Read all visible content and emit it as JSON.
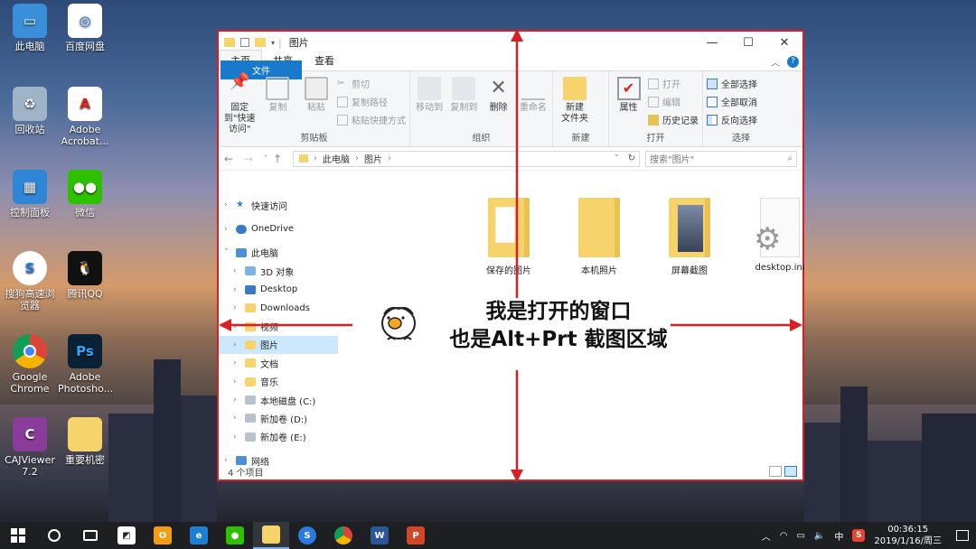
{
  "desktop_icons": [
    {
      "label": "此电脑",
      "icon": "pc-icon"
    },
    {
      "label": "百度网盘",
      "icon": "baidu-netdisk-icon"
    },
    {
      "label": "回收站",
      "icon": "recycle-bin-icon"
    },
    {
      "label": "Adobe Acrobat...",
      "icon": "acrobat-icon"
    },
    {
      "label": "控制面板",
      "icon": "control-panel-icon"
    },
    {
      "label": "微信",
      "icon": "wechat-icon"
    },
    {
      "label": "搜狗高速浏览器",
      "icon": "sogou-browser-icon"
    },
    {
      "label": "腾讯QQ",
      "icon": "qq-icon"
    },
    {
      "label": "Google Chrome",
      "icon": "chrome-icon"
    },
    {
      "label": "Adobe Photosho...",
      "icon": "photoshop-icon"
    },
    {
      "label": "CAJViewer 7.2",
      "icon": "cajviewer-icon"
    },
    {
      "label": "重要机密",
      "icon": "folder-icon"
    }
  ],
  "window": {
    "title": "图片",
    "tabs": [
      "文件",
      "主页",
      "共享",
      "查看"
    ],
    "ribbon": {
      "clipboard": {
        "pin": "固定到\"快速访问\"",
        "copy": "复制",
        "paste": "粘贴",
        "cut": "剪切",
        "copy_path": "复制路径",
        "paste_shortcut": "粘贴快捷方式",
        "label": "剪贴板"
      },
      "organize": {
        "move_to": "移动到",
        "copy_to": "复制到",
        "delete": "删除",
        "rename": "重命名",
        "label": "组织"
      },
      "new": {
        "new_folder": "新建\n文件夹",
        "label": "新建"
      },
      "open": {
        "properties": "属性",
        "open": "打开",
        "edit": "编辑",
        "history": "历史记录",
        "label": "打开"
      },
      "select": {
        "select_all": "全部选择",
        "select_none": "全部取消",
        "invert": "反向选择",
        "label": "选择"
      }
    },
    "address": {
      "path": [
        "此电脑",
        "图片"
      ],
      "search_placeholder": "搜索\"图片\""
    },
    "nav": [
      {
        "label": "快速访问",
        "level": 0
      },
      {
        "label": "OneDrive",
        "level": 0
      },
      {
        "label": "此电脑",
        "level": 0
      },
      {
        "label": "3D 对象",
        "level": 1
      },
      {
        "label": "Desktop",
        "level": 1
      },
      {
        "label": "Downloads",
        "level": 1
      },
      {
        "label": "视频",
        "level": 1
      },
      {
        "label": "图片",
        "level": 1
      },
      {
        "label": "文档",
        "level": 1
      },
      {
        "label": "音乐",
        "level": 1
      },
      {
        "label": "本地磁盘 (C:)",
        "level": 1
      },
      {
        "label": "新加卷 (D:)",
        "level": 1
      },
      {
        "label": "新加卷 (E:)",
        "level": 1
      },
      {
        "label": "网络",
        "level": 0
      }
    ],
    "files": [
      "保存的图片",
      "本机照片",
      "屏幕截图",
      "desktop.ini"
    ],
    "status": "4 个项目"
  },
  "overlay": {
    "line1": "我是打开的窗口",
    "line2": "也是Alt+Prt 截图区域"
  },
  "taskbar": {
    "time": "00:36:15",
    "date": "2019/1/16/周三",
    "ime": "中"
  },
  "colors": {
    "accent": "#1979ca",
    "highlight": "#d71f26",
    "selection": "#cce8ff"
  }
}
